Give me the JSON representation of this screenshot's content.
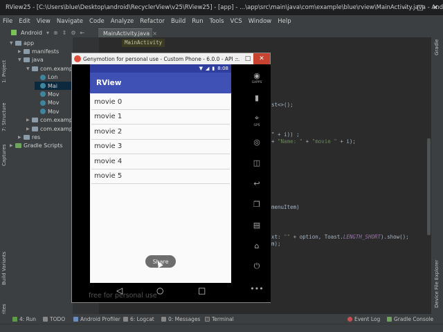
{
  "window": {
    "title": "RView25 - [C:\\Users\\blue\\Desktop\\android\\RecyclerView\\v25\\RView25] - [app] - ...\\app\\src\\main\\java\\com\\example\\blue\\rview\\MainActivity.java - Android Studio 3.0.1"
  },
  "menu": [
    "File",
    "Edit",
    "View",
    "Navigate",
    "Code",
    "Analyze",
    "Refactor",
    "Build",
    "Run",
    "Tools",
    "VCS",
    "Window",
    "Help"
  ],
  "toolbar": {
    "project_root": "app",
    "view_mode": "Android"
  },
  "editor": {
    "tab_label": "MainActivity.java",
    "breadcrumb": "MainActivity",
    "code_lines": [
      "st<>();",
      "\" + i)) ;",
      "+ \"Name: \" + \"movie \" + i);",
      "menuItem)",
      "xt: \"\" + option, Toast.LENGTH_SHORT).show();",
      "m);"
    ],
    "code_strings": [
      "\"Name: \"",
      "\"movie \"",
      "\"\""
    ],
    "code_const": "LENGTH_SHORT"
  },
  "project_tree": [
    {
      "label": "app",
      "depth": 0,
      "type": "folder"
    },
    {
      "label": "manifests",
      "depth": 1,
      "type": "folder"
    },
    {
      "label": "java",
      "depth": 1,
      "type": "folder"
    },
    {
      "label": "com.examp",
      "depth": 2,
      "type": "folder"
    },
    {
      "label": "Lon",
      "depth": 3,
      "type": "class"
    },
    {
      "label": "Mai",
      "depth": 3,
      "type": "class",
      "selected": true
    },
    {
      "label": "Mov",
      "depth": 3,
      "type": "class"
    },
    {
      "label": "Mov",
      "depth": 3,
      "type": "class"
    },
    {
      "label": "Mov",
      "depth": 3,
      "type": "class"
    },
    {
      "label": "com.examp",
      "depth": 2,
      "type": "folder"
    },
    {
      "label": "com.examp",
      "depth": 2,
      "type": "folder"
    },
    {
      "label": "res",
      "depth": 1,
      "type": "folder"
    },
    {
      "label": "Gradle Scripts",
      "depth": 0,
      "type": "gradle"
    }
  ],
  "left_tool_windows": [
    "1: Project",
    "7: Structure",
    "Captures",
    "Build Variants",
    "2: Favorites"
  ],
  "right_tool_windows": [
    "Gradle",
    "Device File Explorer"
  ],
  "bottom_tools": {
    "left": [
      "4: Run",
      "TODO",
      "Android Profiler",
      "6: Logcat",
      "0: Messages",
      "Terminal"
    ],
    "right": [
      "Event Log",
      "Gradle Console"
    ]
  },
  "genymotion": {
    "title": "Genymotion for personal use - Custom Phone - 6.0.0 - API ...",
    "watermark": "free for personal use",
    "status_time": "8:08",
    "side_labels": [
      "GAPPS",
      "GPS"
    ],
    "app": {
      "title": "RView",
      "items": [
        "movie 0",
        "movie 1",
        "movie 2",
        "movie 3",
        "movie 4",
        "movie 5"
      ],
      "share_label": "Share"
    },
    "colors": {
      "primary": "#3f51b5",
      "primary_dark": "#2f3d9e"
    }
  }
}
